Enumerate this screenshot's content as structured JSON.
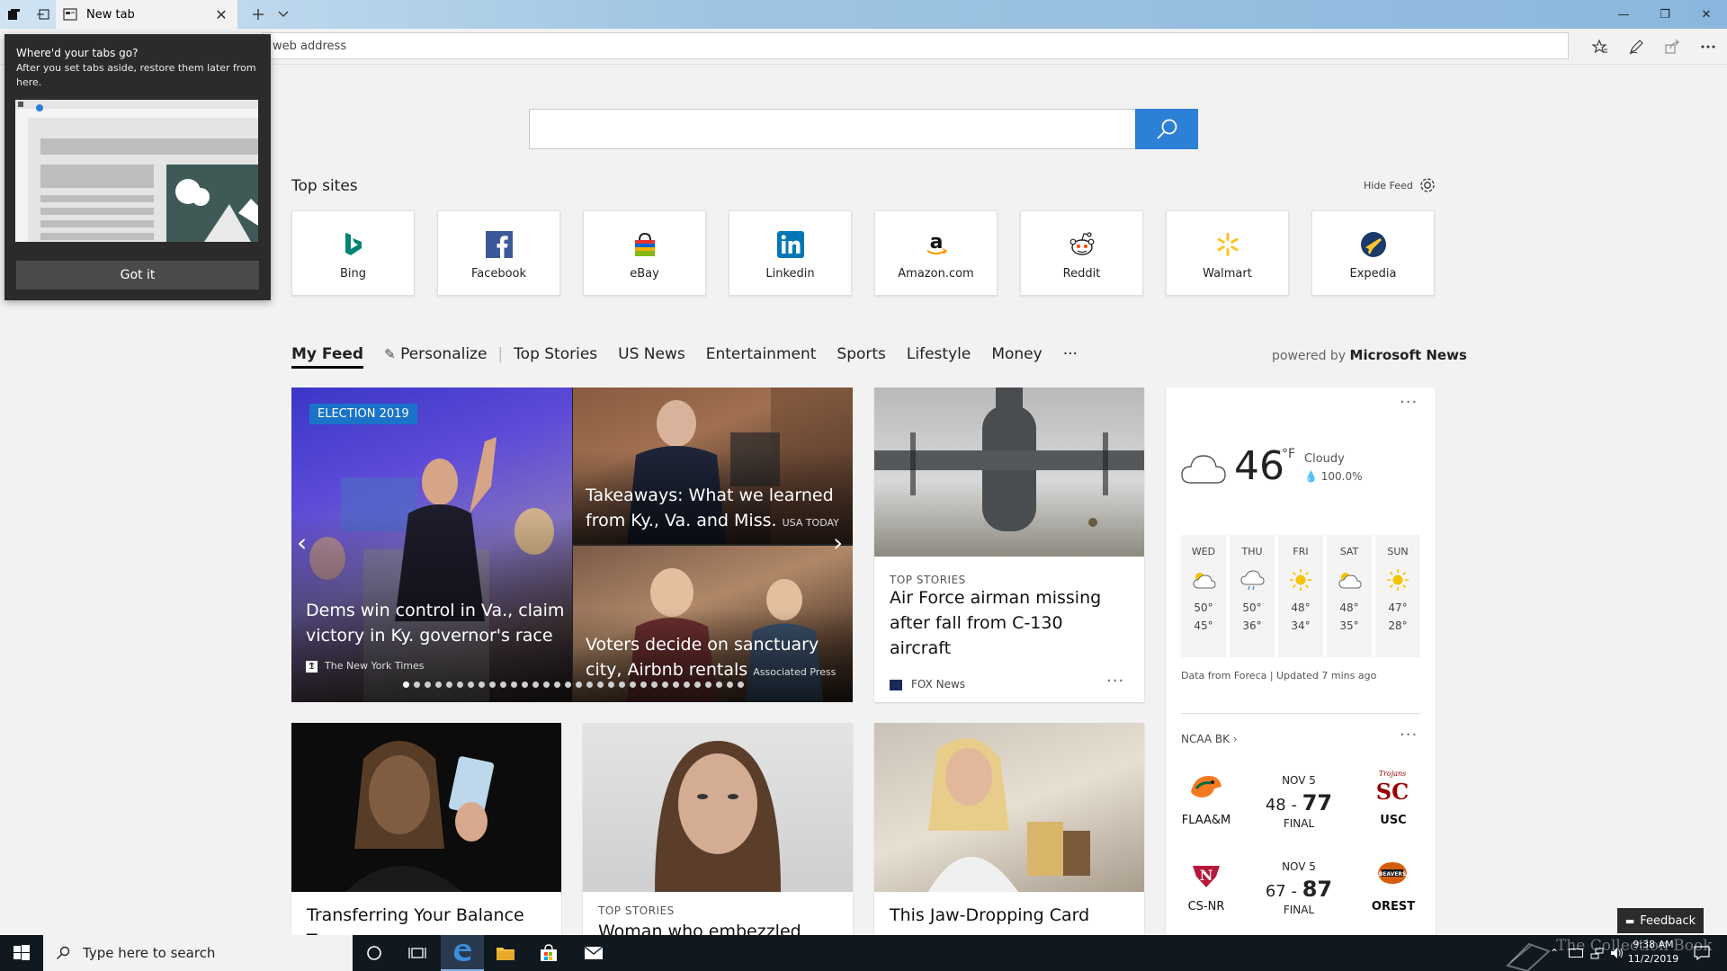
{
  "window": {
    "tab_title": "New tab",
    "minimize": "—",
    "restore": "❐",
    "close": "✕"
  },
  "address_bar": {
    "placeholder": "web address"
  },
  "tabs_aside_popup": {
    "title": "Where'd your tabs go?",
    "body": "After you set tabs aside, restore them later from here.",
    "button": "Got it"
  },
  "top_sites": {
    "title": "Top sites",
    "hide_feed": "Hide Feed",
    "sites": [
      {
        "label": "Bing",
        "icon": "bing-icon",
        "color": "#008373"
      },
      {
        "label": "Facebook",
        "icon": "facebook-icon",
        "color": "#3b5998"
      },
      {
        "label": "eBay",
        "icon": "ebay-icon",
        "color": "#e53238"
      },
      {
        "label": "Linkedin",
        "icon": "linkedin-icon",
        "color": "#0077b5"
      },
      {
        "label": "Amazon.com",
        "icon": "amazon-icon",
        "color": "#000000"
      },
      {
        "label": "Reddit",
        "icon": "reddit-icon",
        "color": "#ff4500"
      },
      {
        "label": "Walmart",
        "icon": "walmart-icon",
        "color": "#ffc220"
      },
      {
        "label": "Expedia",
        "icon": "expedia-icon",
        "color": "#1b3a6b"
      }
    ]
  },
  "feed_nav": {
    "items": [
      "My Feed",
      "Personalize",
      "Top Stories",
      "US News",
      "Entertainment",
      "Sports",
      "Lifestyle",
      "Money",
      "···"
    ],
    "powered_prefix": "powered by",
    "powered_brand": "Microsoft News"
  },
  "hero": {
    "badge": "ELECTION 2019",
    "main_headline": "Dems win control in Va., claim victory in Ky. governor's race",
    "main_source": "The New York Times",
    "tr_headline": "Takeaways: What we learned from Ky., Va. and Miss.",
    "tr_source": "USA TODAY",
    "br_headline": "Voters decide on sanctuary city, Airbnb rentals",
    "br_source": "Associated Press",
    "prev": "‹",
    "next": "›"
  },
  "stories": [
    {
      "category": "TOP STORIES",
      "headline": "Air Force airman missing after fall from C-130 aircraft",
      "source": "FOX News"
    },
    {
      "category": "",
      "headline": "Transferring Your Balance To",
      "source": ""
    },
    {
      "category": "TOP STORIES",
      "headline": "Woman who embezzled",
      "source": ""
    },
    {
      "category": "",
      "headline": "This Jaw-Dropping Card",
      "source": ""
    }
  ],
  "weather": {
    "temp": "46",
    "unit": "°F",
    "condition": "Cloudy",
    "precip": "100.0%",
    "forecast": [
      {
        "day": "WED",
        "hi": "50°",
        "lo": "45°",
        "icon": "partly-sunny-icon"
      },
      {
        "day": "THU",
        "hi": "50°",
        "lo": "36°",
        "icon": "rain-cloud-icon"
      },
      {
        "day": "FRI",
        "hi": "48°",
        "lo": "34°",
        "icon": "sun-icon"
      },
      {
        "day": "SAT",
        "hi": "48°",
        "lo": "35°",
        "icon": "partly-sunny-icon"
      },
      {
        "day": "SUN",
        "hi": "47°",
        "lo": "28°",
        "icon": "sun-icon"
      }
    ],
    "footer": "Data from Foreca | Updated 7 mins ago"
  },
  "sports": {
    "league": "NCAA BK",
    "games": [
      {
        "date": "NOV 5",
        "score_a": "48",
        "score_b": "77",
        "status": "FINAL",
        "team_a": "FLAA&M",
        "team_b": "USC"
      },
      {
        "date": "NOV 5",
        "score_a": "67",
        "score_b": "87",
        "status": "FINAL",
        "team_a": "CS-NR",
        "team_b": "OREST"
      }
    ]
  },
  "feedback": "Feedback",
  "taskbar": {
    "search_placeholder": "Type here to search",
    "time": "9:38 AM",
    "date": "11/2/2019",
    "watermark": "The Collection Book"
  }
}
